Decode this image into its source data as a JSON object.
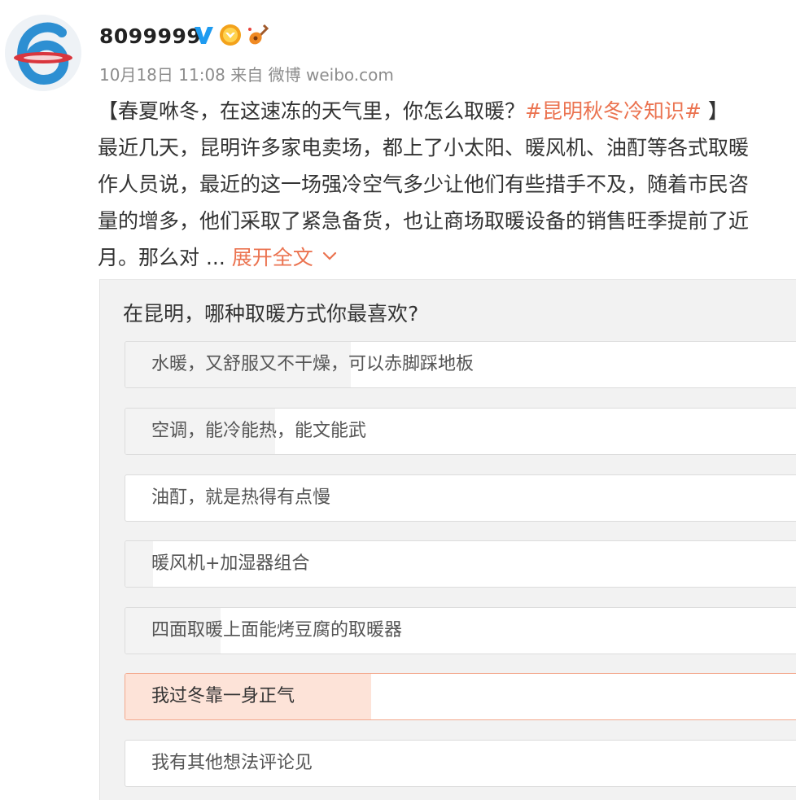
{
  "user": {
    "name": "8099999",
    "avatar_icon": "avatar-logo-6-icon",
    "badges": [
      "verified-v-icon",
      "gold-medal-icon",
      "guitar-icon"
    ]
  },
  "meta": {
    "date": "10月18日",
    "time": "11:08",
    "source": "来自 微博 weibo.com"
  },
  "post": {
    "line1_prefix": "【春夏咻冬，在这速冻的天气里，你怎么取暖？",
    "topic": "#昆明秋冬冷知识#",
    "line1_suffix": " 】",
    "line2": "最近几天，昆明许多家电卖场，都上了小太阳、暖风机、油酊等各式取暖",
    "line3": "作人员说，最近的这一场强冷空气多少让他们有些措手不及，随着市民咨",
    "line4": "量的增多，他们采取了紧急备货，也让商场取暖设备的销售旺季提前了近",
    "line5": "月。那么对 ...",
    "expand_label": "展开全文",
    "expand_icon": "chevron-down-icon"
  },
  "poll": {
    "question": "在昆明，哪种取暖方式你最喜欢?",
    "options": [
      {
        "label": "水暖，又舒服又不干燥，可以赤脚踩地板",
        "share": 0.33,
        "selected": false
      },
      {
        "label": "空调，能冷能热，能文能武",
        "share": 0.22,
        "selected": false
      },
      {
        "label": "油酊，就是热得有点慢",
        "share": 0.0,
        "selected": false
      },
      {
        "label": "暖风机+加湿器组合",
        "share": 0.04,
        "selected": false
      },
      {
        "label": "四面取暖上面能烤豆腐的取暖器",
        "share": 0.14,
        "selected": false
      },
      {
        "label": "我过冬靠一身正气",
        "share": 0.36,
        "selected": true
      },
      {
        "label": "我有其他想法评论见",
        "share": 0.0,
        "selected": false
      }
    ]
  },
  "colors": {
    "accent": "#eb7350",
    "verified": "#1e9bf0",
    "selected_fill": "#fde3d8",
    "selected_border": "#f3a98e"
  }
}
